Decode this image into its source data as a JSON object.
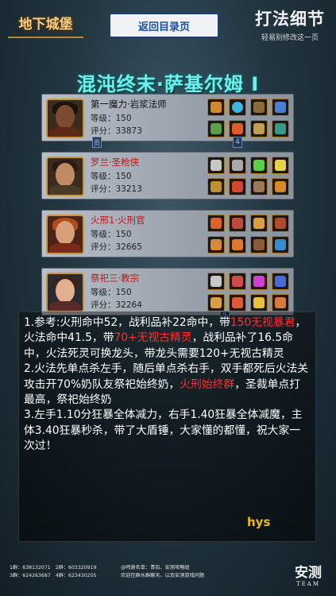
{
  "header": {
    "logo_text": "地下城堡",
    "back_button_label": "返回目录页",
    "section_title": "打法细节",
    "section_subtitle": "轻易别修改这一页"
  },
  "boss": {
    "title": "混沌终末·萨基尔姆 I"
  },
  "players": [
    {
      "name": "第一魔力·岩浆法师",
      "level": "等级：150",
      "score": "评分：33873",
      "name_color": "#111111",
      "badge": "贡"
    },
    {
      "name": "罗兰·圣枪侠",
      "level": "等级：150",
      "score": "评分：33213",
      "name_color": "#b81a1a"
    },
    {
      "name": "火邢1·火刑官",
      "level": "等级：150",
      "score": "评分：32665",
      "name_color": "#b81a1a"
    },
    {
      "name": "祭祀三·教宗",
      "level": "等级：150",
      "score": "评分：32264",
      "name_color": "#b81a1a"
    }
  ],
  "badges": {
    "first_right": "4",
    "last": "5"
  },
  "notes": {
    "p1_a": "1.参考:火刑命中52，战利品补22命中，带",
    "p1_red1": "150无视暴君",
    "p1_b": "，火法命中41.5，带",
    "p1_red2": "70+无视古精灵",
    "p1_c": "，战利品补了16.5命中，火法死灵可换龙头，带龙头需要120+无视古精灵",
    "p2_a": "2.火法先单点杀左手，随后单点杀右手，双手都死后火法关攻击开70%奶队友祭祀始终奶，",
    "p2_red": "火刑始终群",
    "p2_b": "，圣裁单点打最高，祭祀始终奶",
    "p3": "3.左手1.10分狂暴全体减力，右手1.40狂暴全体减魔，主体3.40狂暴秒杀，带了大盾锤，大家懂的都懂，祝大家一次过！"
  },
  "signature": "hys",
  "footer": {
    "group1": "1群：638132071",
    "group2": "2群：603320919",
    "group3": "3群：624263687",
    "group4": "4群：623430205",
    "notice_line1": "@鸣谢名单：青石、安测攻略组",
    "notice_line2": "欢迎在群水群聊天、以及安测游戏问题",
    "team_cn": "安测",
    "team_en": "TEAM"
  },
  "colors": {
    "boss_title": "#6ff0ea",
    "highlight_red": "#ff3030",
    "signature": "#f5b71a",
    "back_button_text": "#1d4f9c"
  }
}
